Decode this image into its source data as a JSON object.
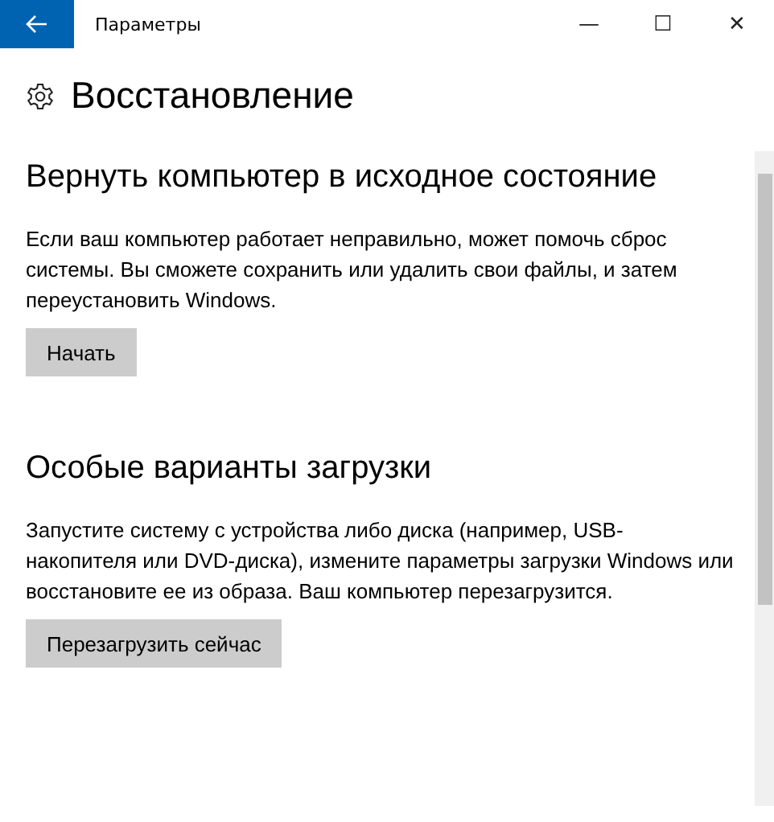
{
  "window": {
    "title": "Параметры",
    "controls": [
      "—",
      "☐",
      "✕"
    ]
  },
  "page": {
    "title": "Восстановление"
  },
  "sections": [
    {
      "title": "Вернуть компьютер в исходное состояние",
      "text": "Если ваш компьютер работает неправильно, может помочь сброс системы. Вы сможете сохранить или удалить свои файлы, и затем переустановить Windows.",
      "button": "Начать"
    },
    {
      "title": "Особые варианты загрузки",
      "text": "Запустите систему с устройства либо диска (например, USB-накопителя или DVD-диска), измените параметры загрузки Windows или восстановите ее из образа. Ваш компьютер перезагрузится.",
      "button": "Перезагрузить сейчас"
    }
  ]
}
